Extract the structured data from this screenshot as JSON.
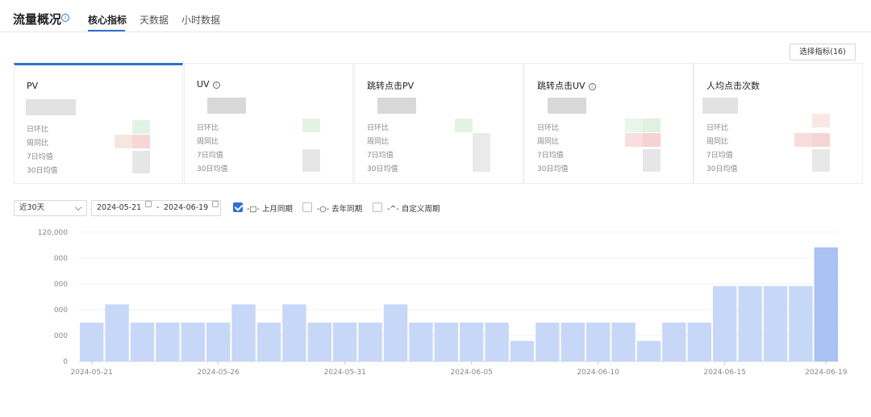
{
  "header": {
    "title": "流量概况",
    "tabs": [
      {
        "label": "核心指标",
        "active": true
      },
      {
        "label": "天数据",
        "active": false
      },
      {
        "label": "小时数据",
        "active": false
      }
    ]
  },
  "toolbar": {
    "select_metrics_label": "选择指标(16)"
  },
  "cards": [
    {
      "title": "PV",
      "has_info": false,
      "active": true
    },
    {
      "title": "UV",
      "has_info": true,
      "active": false
    },
    {
      "title": "跳转点击PV",
      "has_info": false,
      "active": false
    },
    {
      "title": "跳转点击UV",
      "has_info": true,
      "active": false
    },
    {
      "title": "人均点击次数",
      "has_info": false,
      "active": false
    }
  ],
  "card_metric_labels": [
    "日环比",
    "周同比",
    "7日均值",
    "30日均值"
  ],
  "filters": {
    "range_value": "近30天",
    "date_start": "2024-05-21",
    "date_separator": "-",
    "date_end": "2024-06-19",
    "compare_options": [
      {
        "label": "-□- 上月同期",
        "checked": true
      },
      {
        "label": "-○- 去年同期",
        "checked": false
      },
      {
        "label": "-^- 自定义周期",
        "checked": false
      }
    ]
  },
  "colors": {
    "accent": "#2f6fd6",
    "bar": "#c7d7f7",
    "bar_strong": "#a9c1f3"
  },
  "chart_data": {
    "type": "bar",
    "ylim": [
      0,
      120000
    ],
    "yticks": [
      "0",
      "000",
      "000",
      "000",
      "000",
      "120,000"
    ],
    "x": [
      "2024-05-21",
      "2024-05-22",
      "2024-05-23",
      "2024-05-24",
      "2024-05-25",
      "2024-05-26",
      "2024-05-27",
      "2024-05-28",
      "2024-05-29",
      "2024-05-30",
      "2024-05-31",
      "2024-06-01",
      "2024-06-02",
      "2024-06-03",
      "2024-06-04",
      "2024-06-05",
      "2024-06-06",
      "2024-06-07",
      "2024-06-08",
      "2024-06-09",
      "2024-06-10",
      "2024-06-11",
      "2024-06-12",
      "2024-06-13",
      "2024-06-14",
      "2024-06-15",
      "2024-06-16",
      "2024-06-17",
      "2024-06-18",
      "2024-06-19"
    ],
    "xtick_labels": [
      "2024-05-21",
      "2024-05-26",
      "2024-05-31",
      "2024-06-05",
      "2024-06-10",
      "2024-06-15",
      "2024-06-19"
    ],
    "values": [
      36000,
      53000,
      36000,
      36000,
      36000,
      36000,
      53000,
      36000,
      53000,
      36000,
      36000,
      36000,
      53000,
      36000,
      36000,
      36000,
      36000,
      19000,
      36000,
      36000,
      36000,
      36000,
      19000,
      36000,
      36000,
      70000,
      70000,
      70000,
      70000,
      106000
    ]
  }
}
